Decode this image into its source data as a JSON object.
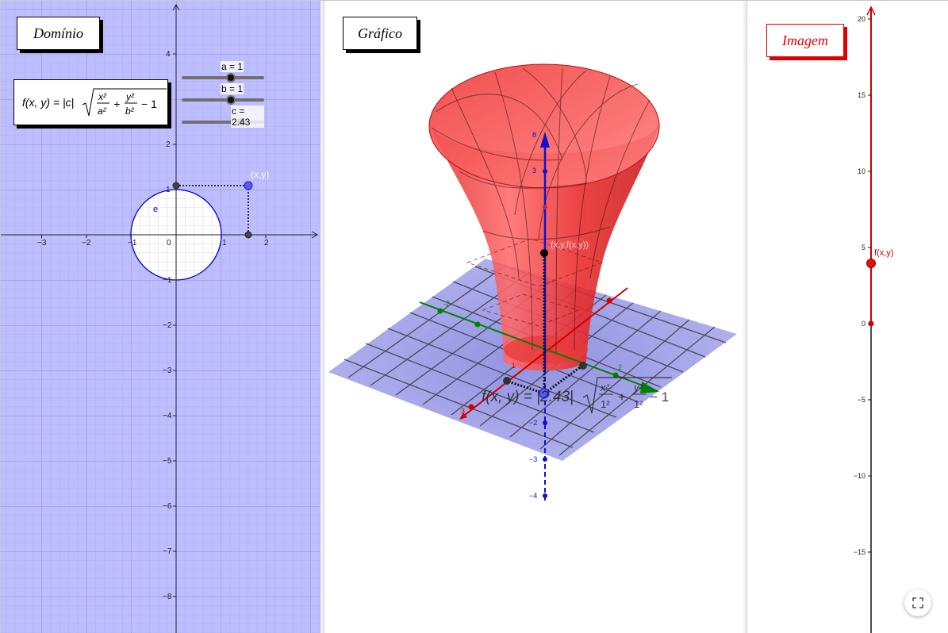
{
  "domain_panel": {
    "title": "Domínio",
    "formula": "f(x,y) = |c| √(x²/a² + y²/b² − 1)",
    "sliders": [
      {
        "label": "a = 1",
        "value": 1
      },
      {
        "label": "b = 1",
        "value": 1
      },
      {
        "label": "c = 2.43",
        "value": 2.43
      }
    ],
    "circle_label": "e",
    "point_label": "(x,y)",
    "x_ticks": [
      "−3",
      "−2",
      "−1",
      "0",
      "1",
      "2"
    ],
    "y_ticks": [
      "4",
      "2",
      "1",
      "−1",
      "−2",
      "−3",
      "−4",
      "−5",
      "−6",
      "−7",
      "−8"
    ],
    "background_color": "#bdbdff",
    "circle_color": "#0000cc"
  },
  "graph_panel": {
    "title": "Gráfico",
    "formula_label": "f(x,y) = |2.43| √(x²/1² + y²/1² − 1)",
    "surface_color": "#e00000",
    "z_ticks": [
      "3",
      "−2",
      "−3",
      "−4"
    ],
    "point_label": "(x,y,f(x,y))"
  },
  "image_panel": {
    "title": "Imagem",
    "ticks": [
      "20",
      "15",
      "10",
      "5",
      "0",
      "−5",
      "−10",
      "−15"
    ],
    "point_label": "f(x,y)",
    "axis_color": "#cc0000"
  },
  "controls": {
    "fullscreen_icon": "fullscreen-icon"
  }
}
